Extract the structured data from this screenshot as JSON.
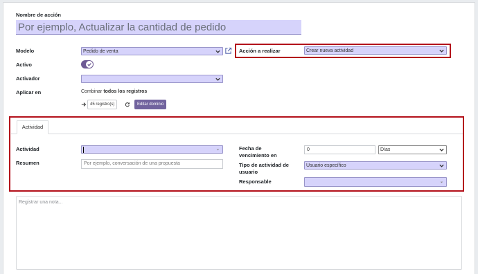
{
  "form": {
    "action_name_label": "Nombre de acción",
    "action_name_placeholder": "Por ejemplo, Actualizar la cantidad de pedido",
    "model_label": "Modelo",
    "model_value": "Pedido de venta",
    "active_label": "Activo",
    "active_value": true,
    "trigger_label": "Activador",
    "trigger_value": "",
    "apply_on_label": "Aplicar en",
    "apply_on_text_prefix": "Combinar",
    "apply_on_text_bold": "todos los registros",
    "record_count_label": "45 registro(s)",
    "edit_domain_label": "Editar dominio",
    "action_to_do_label": "Acción a realizar",
    "action_to_do_value": "Crear nueva actividad"
  },
  "tabs": [
    {
      "label": "Actividad"
    }
  ],
  "activity": {
    "activity_label": "Actividad",
    "activity_value": "",
    "summary_label": "Resumen",
    "summary_placeholder": "Por ejemplo, conversación de una propuesta",
    "due_date_label_line1": "Fecha de",
    "due_date_label_line2": "vencimiento en",
    "due_date_value": "0",
    "due_date_unit": "Días",
    "user_type_label_line1": "Tipo de actividad de",
    "user_type_label_line2": "usuario",
    "user_type_value": "Usuario específico",
    "responsible_label": "Responsable",
    "responsible_value": ""
  },
  "note": {
    "placeholder": "Registrar una nota..."
  },
  "colors": {
    "required_bg": "#d6d3fb",
    "primary": "#71639e",
    "highlight_border": "#b3101a"
  }
}
